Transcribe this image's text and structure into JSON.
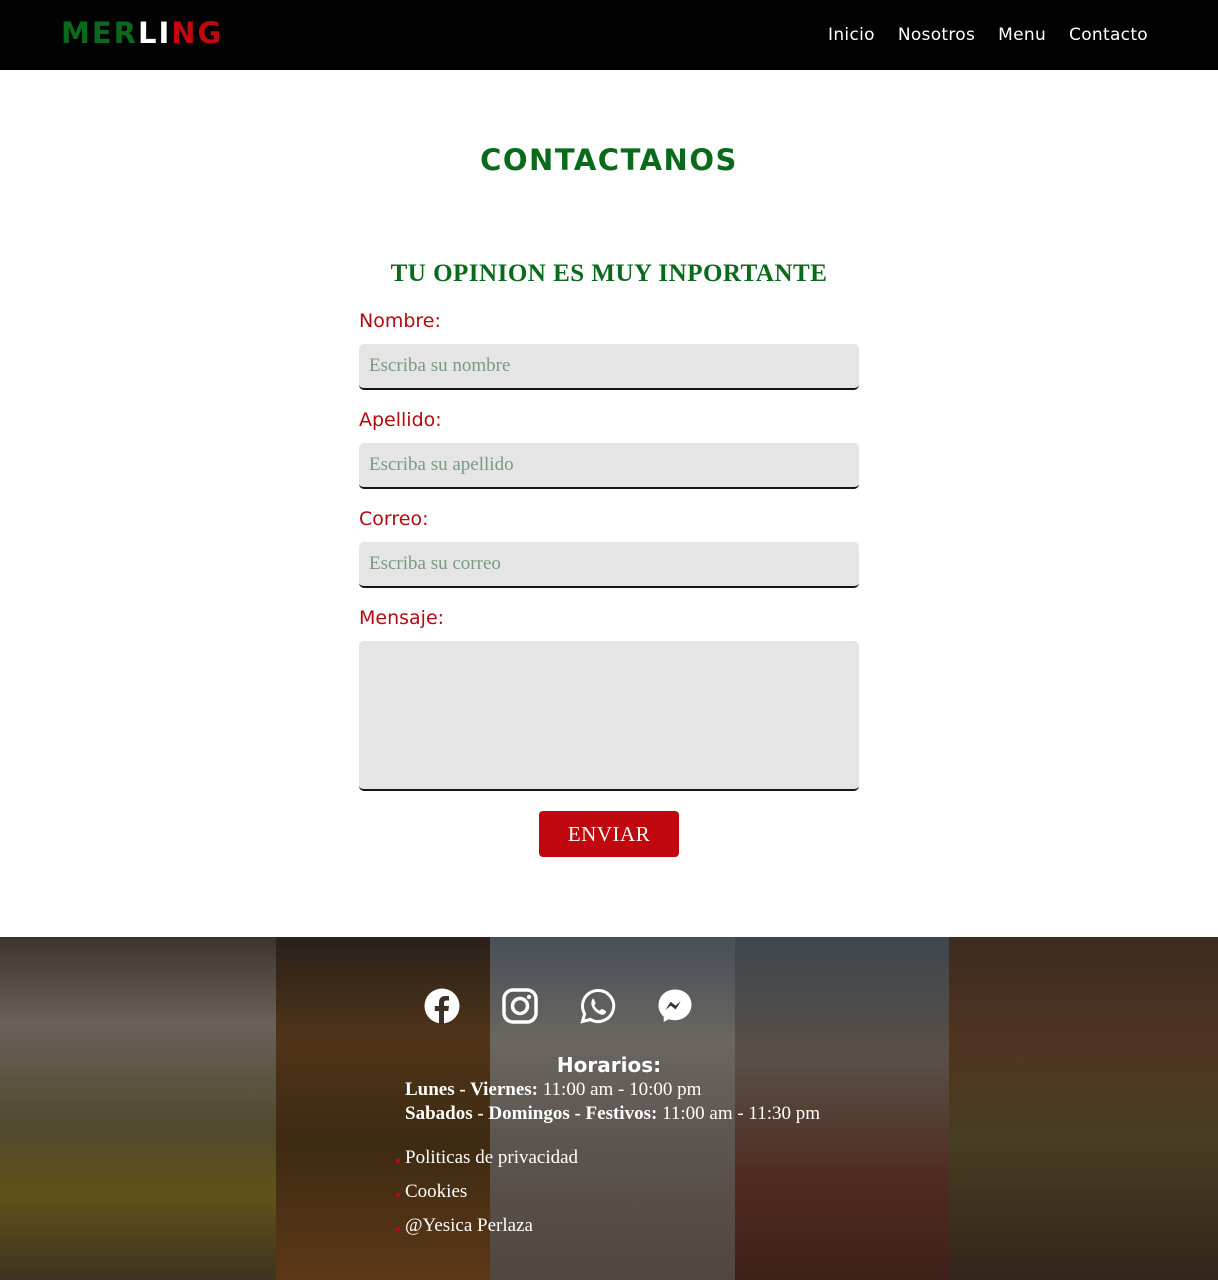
{
  "header": {
    "logo": {
      "part1": "MER",
      "part2": "LI",
      "part3": "NG"
    },
    "nav": [
      "Inicio",
      "Nosotros",
      "Menu",
      "Contacto"
    ]
  },
  "main": {
    "title": "CONTACTANOS",
    "form_title": "TU OPINION ES MUY INPORTANTE",
    "fields": {
      "nombre": {
        "label": "Nombre:",
        "placeholder": "Escriba su nombre"
      },
      "apellido": {
        "label": "Apellido:",
        "placeholder": "Escriba su apellido"
      },
      "correo": {
        "label": "Correo:",
        "placeholder": "Escriba su correo"
      },
      "mensaje": {
        "label": "Mensaje:"
      }
    },
    "submit_label": "ENVIAR"
  },
  "footer": {
    "social_icons": [
      "facebook-icon",
      "instagram-icon",
      "whatsapp-icon",
      "messenger-icon"
    ],
    "hours_title": "Horarios:",
    "hours": [
      {
        "days": "Lunes - Viernes:",
        "time": "11:00 am - 10:00 pm"
      },
      {
        "days": "Sabados - Domingos - Festivos:",
        "time": "11:00 am - 11:30 pm"
      }
    ],
    "links": [
      "Politicas de privacidad",
      "Cookies",
      "@Yesica Perlaza"
    ]
  },
  "colors": {
    "green": "#0a6a1c",
    "red": "#c0080e",
    "black": "#020202",
    "input_bg": "#e5e5e5"
  }
}
